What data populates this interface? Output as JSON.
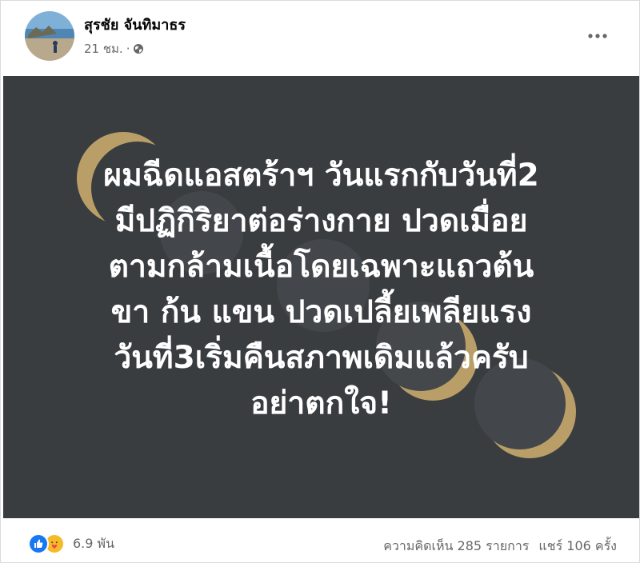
{
  "post": {
    "author": "สุรชัย จันทิมาธร",
    "time": "21 ชม.",
    "separator": "·",
    "privacy_icon": "globe-icon",
    "more_icon": "more-horizontal-icon"
  },
  "card": {
    "background_color": "#3a3d40",
    "accent_color": "#c4a86b",
    "lines": [
      "ผมฉีดแอสตร้าฯ วันแรกกับวันที่2",
      "มีปฏิกิริยาต่อร่างกาย ปวดเมื่อย",
      "ตามกล้ามเนื้อโดยเฉพาะแถวต้น",
      "ขา ก้น แขน ปวดเปลี้ยเพลียแรง",
      "วันที่3เริ่มคืนสภาพเดิมแล้วครับ",
      "อย่าตกใจ!"
    ]
  },
  "footer": {
    "reaction_icons": [
      "like-icon",
      "care-icon"
    ],
    "reaction_count": "6.9 พัน",
    "comments": "ความคิดเห็น 285 รายการ",
    "shares": "แชร์ 106 ครั้ง"
  }
}
